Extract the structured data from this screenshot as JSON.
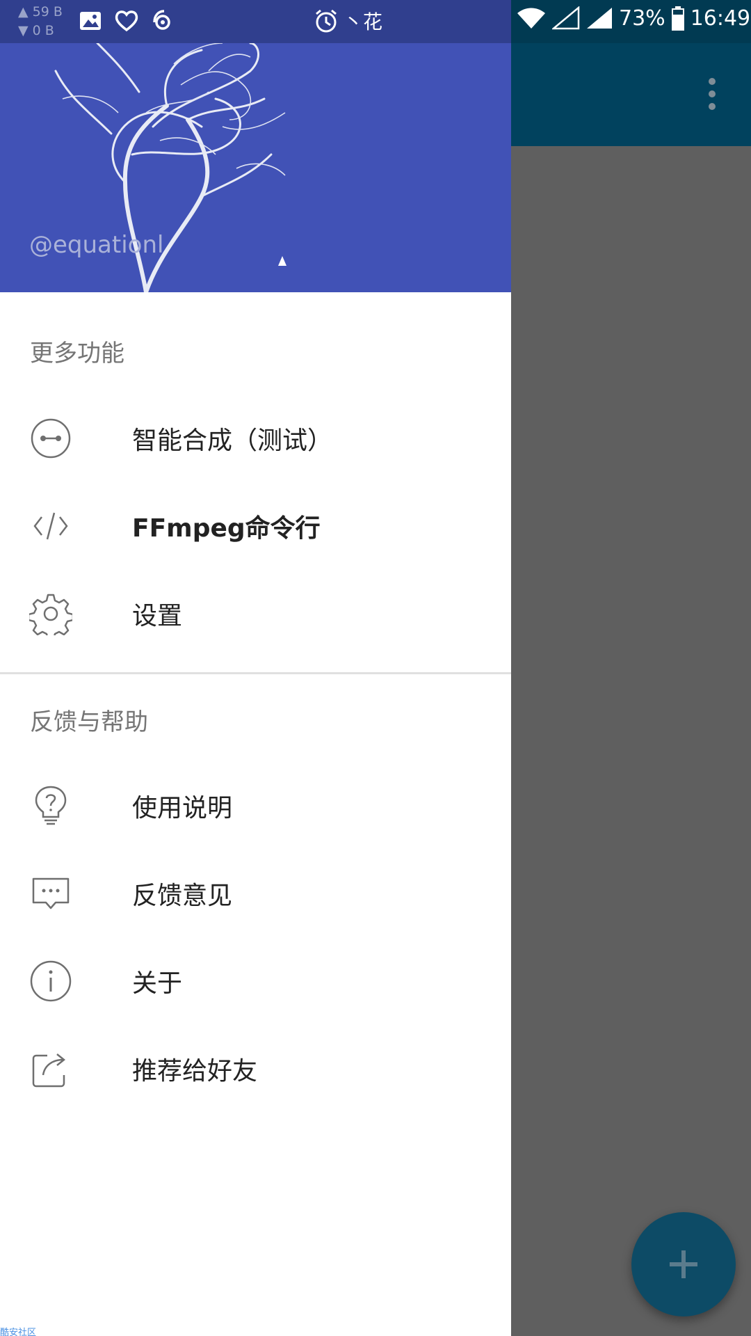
{
  "status_bar": {
    "upload_speed": "▲ 59 B",
    "download_speed": "▼ 0 B",
    "carrier_text": "丶花",
    "battery": "73%",
    "time": "16:49"
  },
  "drawer": {
    "header": {
      "username": "@equationl"
    },
    "sections": [
      {
        "title": "更多功能",
        "items": [
          {
            "label": "智能合成（测试）",
            "icon": "merge-icon"
          },
          {
            "label": "FFmpeg命令行",
            "icon": "code-icon"
          },
          {
            "label": "设置",
            "icon": "gear-icon"
          }
        ]
      },
      {
        "title": "反馈与帮助",
        "items": [
          {
            "label": "使用说明",
            "icon": "lightbulb-help-icon"
          },
          {
            "label": "反馈意见",
            "icon": "chat-bubble-icon"
          },
          {
            "label": "关于",
            "icon": "info-icon"
          },
          {
            "label": "推荐给好友",
            "icon": "share-icon"
          }
        ]
      }
    ]
  },
  "watermark": "酷安社区",
  "colors": {
    "drawer_header": "#4152b6",
    "status_bar_left": "#303f8e",
    "app_toolbar": "#01425e",
    "scrim": "#5f5f5f",
    "fab": "#0d4b66"
  }
}
